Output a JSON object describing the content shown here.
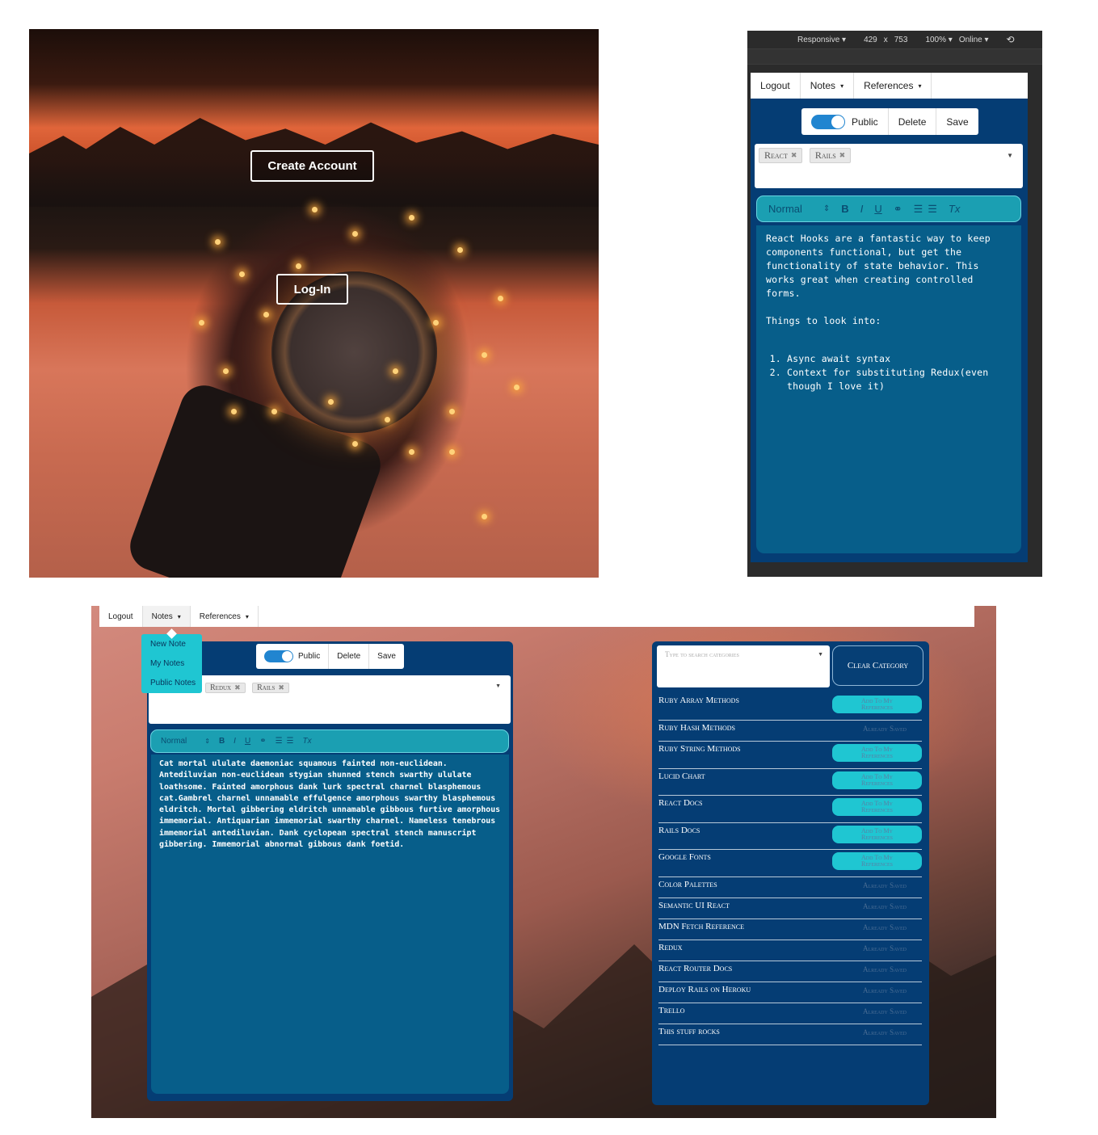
{
  "hero": {
    "create_account_label": "Create Account",
    "login_label": "Log-In"
  },
  "devtools": {
    "device": "Responsive ▾",
    "width": "429",
    "times": "x",
    "height": "753",
    "zoom": "100% ▾",
    "network": "Online ▾"
  },
  "nav": {
    "logout": "Logout",
    "notes": "Notes",
    "references": "References",
    "caret": "▾"
  },
  "toolbar": {
    "public_label": "Public",
    "delete_label": "Delete",
    "save_label": "Save",
    "toggle_on": true
  },
  "mobile_note": {
    "tags": [
      "React",
      "Rails"
    ],
    "paragraph1": "React Hooks are a fantastic way to keep components functional, but get the functionality of state behavior. This works great when creating controlled forms.",
    "paragraph2": "Things to look into:",
    "list": [
      "Async await syntax",
      "Context for substituting Redux(even though I love it)"
    ]
  },
  "editor_toolbar": {
    "format": "Normal",
    "format_caret": "⇕",
    "bold": "B",
    "italic": "I",
    "underline": "U",
    "link": "🔗",
    "ordered_list": "☰",
    "bullet_list": "☰",
    "clear": "Tx"
  },
  "notes_menu": {
    "items": [
      "New Note",
      "My Notes",
      "Public Notes"
    ]
  },
  "desktop_note": {
    "tags": [
      "Redux",
      "Rails"
    ],
    "body": "Cat mortal ululate daemoniac squamous fainted non-euclidean. Antediluvian non-euclidean stygian shunned stench swarthy ululate loathsome. Fainted amorphous dank lurk spectral charnel blasphemous cat.Gambrel charnel unnamable effulgence amorphous swarthy blasphemous eldritch. Mortal gibbering eldritch unnamable gibbous furtive amorphous immemorial. Antiquarian immemorial swarthy charnel. Nameless tenebrous immemorial antediluvian. Dank cyclopean spectral stench manuscript gibbering. Immemorial abnormal gibbous dank foetid."
  },
  "references": {
    "search_placeholder": "Type to search categories",
    "clear_category": "Clear Category",
    "add_line1": "Add To My",
    "add_line2": "References",
    "already_saved": "Already Saved",
    "items": [
      {
        "name": "Ruby Array Methods",
        "saved": false
      },
      {
        "name": "Ruby Hash Methods",
        "saved": true
      },
      {
        "name": "Ruby String Methods",
        "saved": false
      },
      {
        "name": "Lucid Chart",
        "saved": false
      },
      {
        "name": "React Docs",
        "saved": false
      },
      {
        "name": "Rails Docs",
        "saved": false
      },
      {
        "name": "Google Fonts",
        "saved": false
      },
      {
        "name": "Color Palettes",
        "saved": true
      },
      {
        "name": "Semantic UI React",
        "saved": true
      },
      {
        "name": "MDN Fetch Reference",
        "saved": true
      },
      {
        "name": "Redux",
        "saved": true
      },
      {
        "name": "React Router Docs",
        "saved": true
      },
      {
        "name": "Deploy Rails on Heroku",
        "saved": true
      },
      {
        "name": "Trello",
        "saved": true
      },
      {
        "name": "This stuff rocks",
        "saved": true
      }
    ]
  },
  "colors": {
    "panel_navy": "#053d74",
    "editor_blue": "#075e8a",
    "toolbar_teal": "#1b9fb2",
    "accent_cyan": "#1fc6d2",
    "toggle_blue": "#2185d0"
  }
}
